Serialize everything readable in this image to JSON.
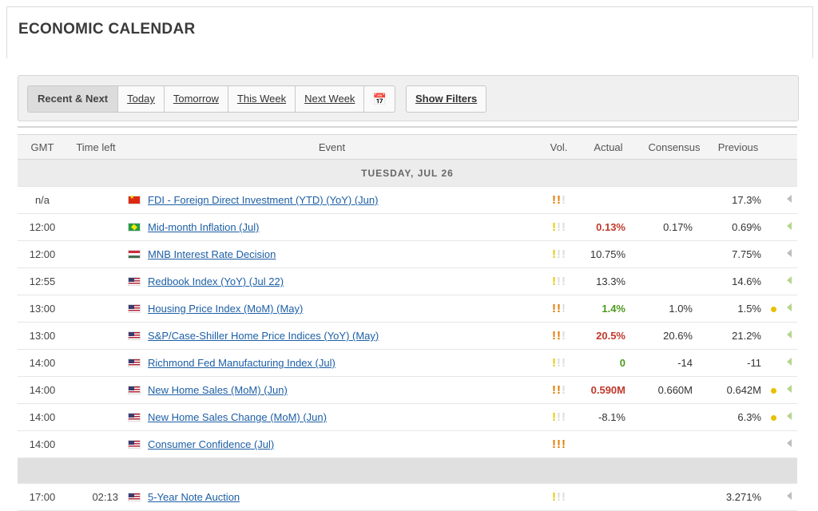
{
  "page": {
    "title": "ECONOMIC CALENDAR"
  },
  "filters": {
    "buttons": [
      "Recent & Next",
      "Today",
      "Tomorrow",
      "This Week",
      "Next Week"
    ],
    "active": "Recent & Next",
    "calendar_icon": "calendar-icon",
    "show_filters": "Show Filters"
  },
  "table": {
    "headers": {
      "gmt": "GMT",
      "time_left": "Time left",
      "event": "Event",
      "vol": "Vol.",
      "actual": "Actual",
      "consensus": "Consensus",
      "previous": "Previous"
    },
    "day_label": "TUESDAY, JUL 26",
    "rows": [
      {
        "gmt": "n/a",
        "time_left": "",
        "flag": "cn",
        "event": "FDI - Foreign Direct Investment (YTD) (YoY) (Jun)",
        "vol": 2,
        "vol_color": "high",
        "actual": "",
        "actual_color": "plain",
        "consensus": "",
        "previous": "17.3%",
        "revised": false,
        "arrow": "gray"
      },
      {
        "gmt": "12:00",
        "time_left": "",
        "flag": "br",
        "event": "Mid-month Inflation (Jul)",
        "vol": 1,
        "vol_color": "low",
        "actual": "0.13%",
        "actual_color": "red",
        "consensus": "0.17%",
        "previous": "0.69%",
        "revised": false,
        "arrow": "green"
      },
      {
        "gmt": "12:00",
        "time_left": "",
        "flag": "hu",
        "event": "MNB Interest Rate Decision",
        "vol": 1,
        "vol_color": "low",
        "actual": "10.75%",
        "actual_color": "plain",
        "consensus": "",
        "previous": "7.75%",
        "revised": false,
        "arrow": "gray"
      },
      {
        "gmt": "12:55",
        "time_left": "",
        "flag": "us",
        "event": "Redbook Index (YoY) (Jul 22)",
        "vol": 1,
        "vol_color": "low",
        "actual": "13.3%",
        "actual_color": "plain",
        "consensus": "",
        "previous": "14.6%",
        "revised": false,
        "arrow": "green"
      },
      {
        "gmt": "13:00",
        "time_left": "",
        "flag": "us",
        "event": "Housing Price Index (MoM) (May)",
        "vol": 2,
        "vol_color": "high",
        "actual": "1.4%",
        "actual_color": "green",
        "consensus": "1.0%",
        "previous": "1.5%",
        "revised": true,
        "arrow": "green"
      },
      {
        "gmt": "13:00",
        "time_left": "",
        "flag": "us",
        "event": "S&P/Case-Shiller Home Price Indices (YoY) (May)",
        "vol": 2,
        "vol_color": "high",
        "actual": "20.5%",
        "actual_color": "red",
        "consensus": "20.6%",
        "previous": "21.2%",
        "revised": false,
        "arrow": "green"
      },
      {
        "gmt": "14:00",
        "time_left": "",
        "flag": "us",
        "event": "Richmond Fed Manufacturing Index (Jul)",
        "vol": 1,
        "vol_color": "low",
        "actual": "0",
        "actual_color": "green",
        "consensus": "-14",
        "previous": "-11",
        "revised": false,
        "arrow": "green"
      },
      {
        "gmt": "14:00",
        "time_left": "",
        "flag": "us",
        "event": "New Home Sales (MoM) (Jun)",
        "vol": 2,
        "vol_color": "high",
        "actual": "0.590M",
        "actual_color": "red",
        "consensus": "0.660M",
        "previous": "0.642M",
        "revised": true,
        "arrow": "green"
      },
      {
        "gmt": "14:00",
        "time_left": "",
        "flag": "us",
        "event": "New Home Sales Change (MoM) (Jun)",
        "vol": 1,
        "vol_color": "low",
        "actual": "-8.1%",
        "actual_color": "plain",
        "consensus": "",
        "previous": "6.3%",
        "revised": true,
        "arrow": "green"
      },
      {
        "gmt": "14:00",
        "time_left": "",
        "flag": "us",
        "event": "Consumer Confidence (Jul)",
        "vol": 3,
        "vol_color": "high",
        "actual": "",
        "actual_color": "plain",
        "consensus": "",
        "previous": "",
        "revised": false,
        "arrow": "gray"
      }
    ],
    "upcoming": [
      {
        "gmt": "17:00",
        "time_left": "02:13",
        "flag": "us",
        "event": "5-Year Note Auction",
        "vol": 1,
        "vol_color": "low",
        "actual": "",
        "actual_color": "plain",
        "consensus": "",
        "previous": "3.271%",
        "revised": false,
        "arrow": "gray"
      }
    ]
  },
  "colors": {
    "link": "#1d5fa5",
    "actual_red": "#c0392b",
    "actual_green": "#4c9a1c",
    "vol_high": "#e07b00",
    "vol_low": "#e8c800",
    "revised_dot": "#e8c000"
  }
}
